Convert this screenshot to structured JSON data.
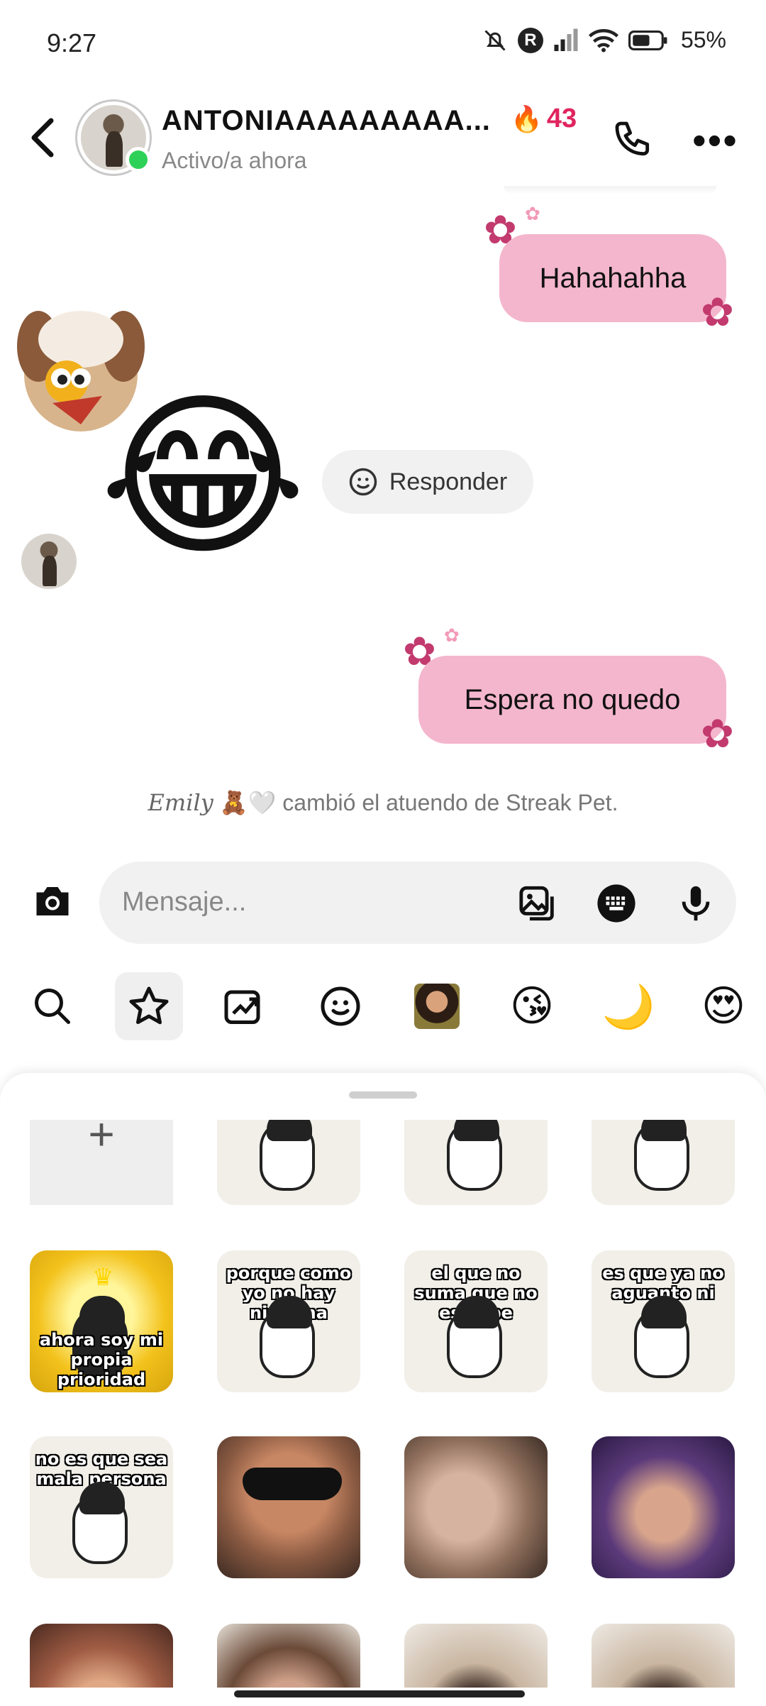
{
  "status_bar": {
    "time": "9:27",
    "battery_percent": "55%",
    "icons": [
      "mute-icon",
      "r-badge-icon",
      "signal-icon",
      "wifi-icon",
      "battery-icon"
    ]
  },
  "header": {
    "name": "ANTONIAAAAAAAAA...",
    "streak_count": "43",
    "status": "Activo/a ahora"
  },
  "messages": {
    "msg1": "Hahahahha",
    "reply_label": "Responder",
    "msg2": "Espera no quedo",
    "system_name": "Emily",
    "system_text": "cambió el atuendo de Streak Pet."
  },
  "composer": {
    "placeholder": "Mensaje..."
  },
  "stickers": {
    "row2": [
      {
        "top": "",
        "bottom": "ahora soy mi propia prioridad"
      },
      {
        "top": "porque como yo no hay ninguna"
      },
      {
        "top": "el que no suma que no estorbe"
      },
      {
        "top": "es que ya no aguanto ni una"
      }
    ],
    "row3": [
      {
        "top": "no es que sea mala persona"
      }
    ]
  },
  "colors": {
    "bubble": "#f4b6cc",
    "flower": "#c23a6e",
    "online": "#2ed158",
    "streak": "#e0245e"
  }
}
